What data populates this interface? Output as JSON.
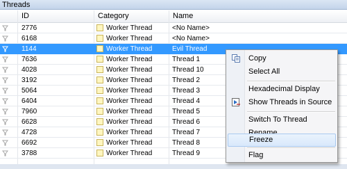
{
  "panel": {
    "title": "Threads"
  },
  "columns": {
    "id": "ID",
    "category": "Category",
    "name": "Name"
  },
  "rows": [
    {
      "id": "2776",
      "category": "Worker Thread",
      "name": "<No Name>",
      "selected": false
    },
    {
      "id": "6168",
      "category": "Worker Thread",
      "name": "<No Name>",
      "selected": false
    },
    {
      "id": "1144",
      "category": "Worker Thread",
      "name": "Evil Thread",
      "selected": true
    },
    {
      "id": "7636",
      "category": "Worker Thread",
      "name": "Thread 1",
      "selected": false
    },
    {
      "id": "4028",
      "category": "Worker Thread",
      "name": "Thread 10",
      "selected": false
    },
    {
      "id": "3192",
      "category": "Worker Thread",
      "name": "Thread 2",
      "selected": false
    },
    {
      "id": "5064",
      "category": "Worker Thread",
      "name": "Thread 3",
      "selected": false
    },
    {
      "id": "6404",
      "category": "Worker Thread",
      "name": "Thread 4",
      "selected": false
    },
    {
      "id": "7960",
      "category": "Worker Thread",
      "name": "Thread 5",
      "selected": false
    },
    {
      "id": "6628",
      "category": "Worker Thread",
      "name": "Thread 6",
      "selected": false
    },
    {
      "id": "4728",
      "category": "Worker Thread",
      "name": "Thread 7",
      "selected": false
    },
    {
      "id": "6692",
      "category": "Worker Thread",
      "name": "Thread 8",
      "selected": false
    },
    {
      "id": "3788",
      "category": "Worker Thread",
      "name": "Thread 9",
      "selected": false
    }
  ],
  "context_menu": {
    "copy": "Copy",
    "select_all": "Select All",
    "hex_display": "Hexadecimal Display",
    "show_threads": "Show Threads in Source",
    "switch_thread": "Switch To Thread",
    "rename": "Rename",
    "freeze": "Freeze",
    "flag": "Flag",
    "highlighted": "freeze"
  },
  "colors": {
    "selection": "#3399ff",
    "category_swatch": "#fff6c0"
  }
}
